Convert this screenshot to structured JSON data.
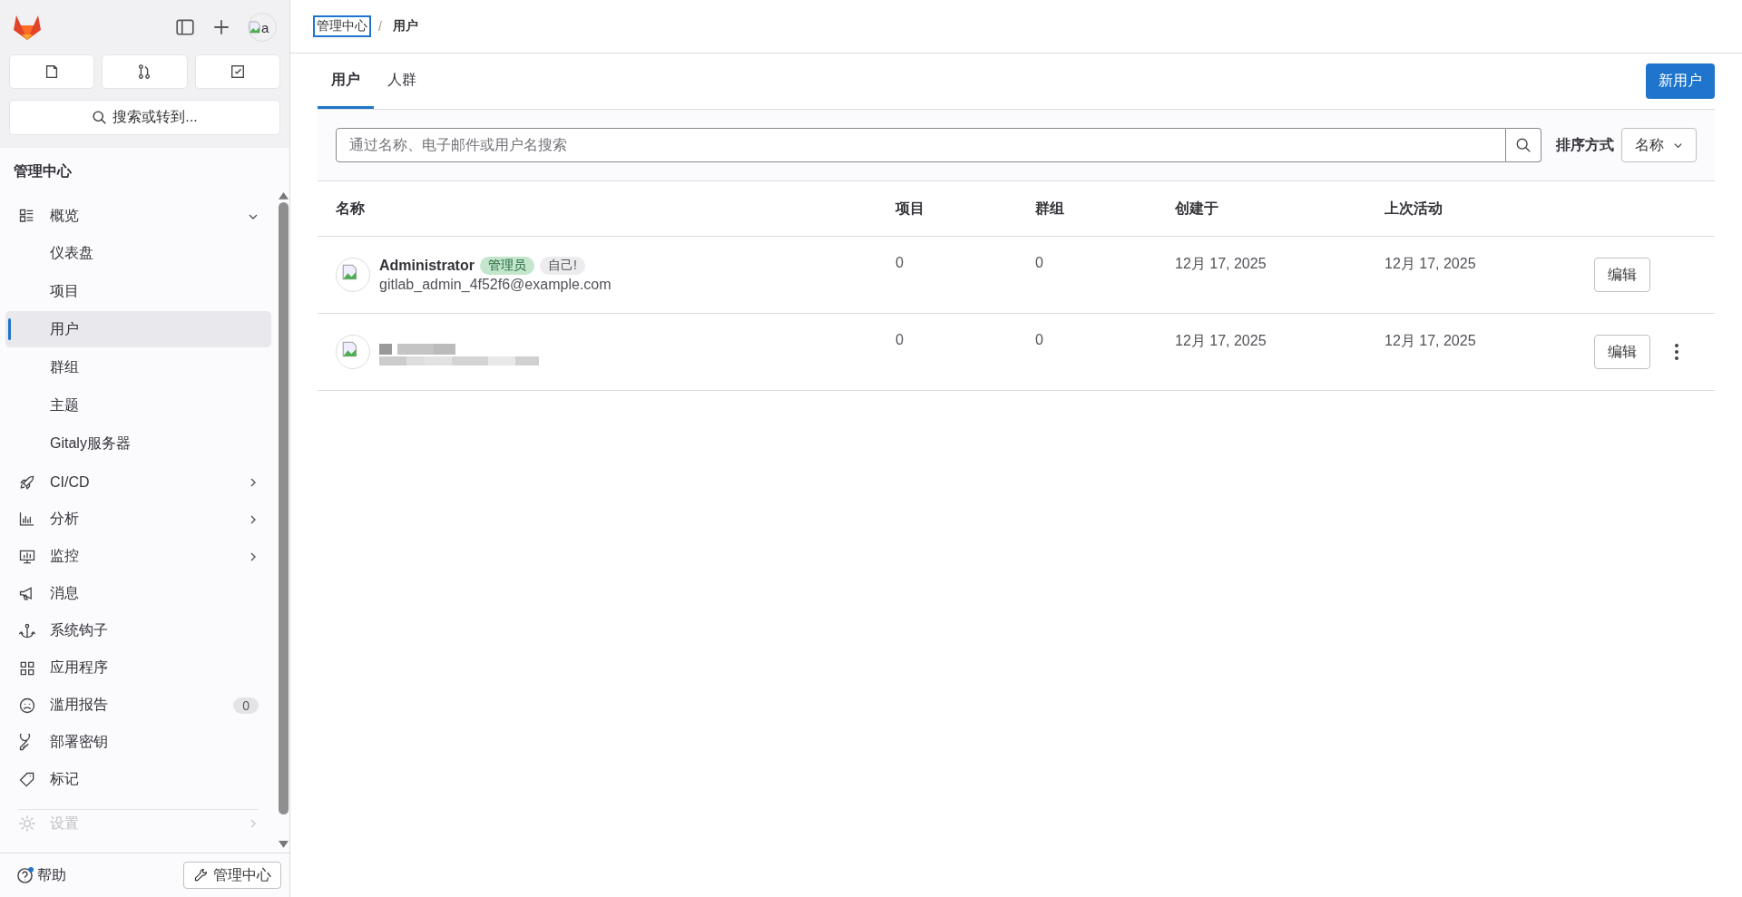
{
  "sidebar": {
    "avatar_alt": "a",
    "search_button": "搜索或转到...",
    "section_title": "管理中心",
    "items": [
      {
        "label": "概览",
        "selected": false,
        "expanded": true,
        "children": [
          {
            "label": "仪表盘",
            "selected": false
          },
          {
            "label": "项目",
            "selected": false
          },
          {
            "label": "用户",
            "selected": true
          },
          {
            "label": "群组",
            "selected": false
          },
          {
            "label": "主题",
            "selected": false
          },
          {
            "label": "Gitaly服务器",
            "selected": false
          }
        ]
      },
      {
        "label": "CI/CD",
        "selected": false,
        "expanded": false
      },
      {
        "label": "分析",
        "selected": false,
        "expanded": false
      },
      {
        "label": "监控",
        "selected": false,
        "expanded": false
      },
      {
        "label": "消息",
        "selected": false
      },
      {
        "label": "系统钩子",
        "selected": false
      },
      {
        "label": "应用程序",
        "selected": false
      },
      {
        "label": "滥用报告",
        "selected": false,
        "count": "0"
      },
      {
        "label": "部署密钥",
        "selected": false
      },
      {
        "label": "标记",
        "selected": false
      },
      {
        "label": "设置",
        "selected": false,
        "expanded": false,
        "faded": true
      }
    ],
    "footer": {
      "help": "帮助",
      "help_notification": true,
      "admin_button": "管理中心"
    }
  },
  "breadcrumb_separator": "/",
  "breadcrumb": [
    {
      "label": "管理中心",
      "focused": true
    },
    {
      "label": "用户",
      "focused": false
    }
  ],
  "tabs": [
    {
      "label": "用户",
      "selected": true
    },
    {
      "label": "人群",
      "selected": false
    }
  ],
  "new_user_button": "新用户",
  "filter": {
    "placeholder": "通过名称、电子邮件或用户名搜索",
    "sort_label": "排序方式",
    "sort_value": "名称"
  },
  "table": {
    "columns": [
      "名称",
      "项目",
      "群组",
      "创建于",
      "上次活动"
    ],
    "rows": [
      {
        "redacted": false,
        "name": "Administrator",
        "badges": [
          {
            "label": "管理员",
            "kind": "admin"
          },
          {
            "label": "自己!",
            "kind": "self"
          }
        ],
        "email": "gitlab_admin_4f52f6@example.com",
        "projects": "0",
        "groups": "0",
        "created": "12月 17, 2025",
        "last_activity": "12月 17, 2025",
        "action": "编辑",
        "more_menu": false
      },
      {
        "redacted": true,
        "projects": "0",
        "groups": "0",
        "created": "12月 17, 2025",
        "last_activity": "12月 17, 2025",
        "action": "编辑",
        "more_menu": true
      }
    ]
  }
}
